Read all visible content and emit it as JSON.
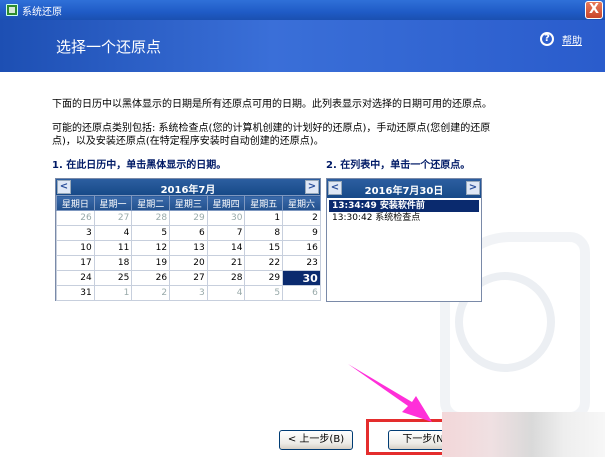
{
  "window": {
    "title": "系统还原",
    "close_glyph": "X"
  },
  "header": {
    "title": "选择一个还原点",
    "help_label": "帮助",
    "help_glyph": "?"
  },
  "description": {
    "line1": "下面的日历中以黑体显示的日期是所有还原点可用的日期。此列表显示对选择的日期可用的还原点。",
    "line2": "可能的还原点类别包括: 系统检查点(您的计算机创建的计划好的还原点)，手动还原点(您创建的还原点)，以及安装还原点(在特定程序安装时自动创建的还原点)。"
  },
  "steps": {
    "step1": "1. 在此日历中，单击黑体显示的日期。",
    "step2": "2. 在列表中，单击一个还原点。"
  },
  "calendar": {
    "month_label": "2016年7月",
    "prev_glyph": "<",
    "next_glyph": ">",
    "weekdays": [
      "星期日",
      "星期一",
      "星期二",
      "星期三",
      "星期四",
      "星期五",
      "星期六"
    ],
    "weeks": [
      [
        {
          "d": "26",
          "o": true
        },
        {
          "d": "27",
          "o": true
        },
        {
          "d": "28",
          "o": true
        },
        {
          "d": "29",
          "o": true
        },
        {
          "d": "30",
          "o": true
        },
        {
          "d": "1",
          "o": false
        },
        {
          "d": "2",
          "o": false
        }
      ],
      [
        {
          "d": "3",
          "o": false
        },
        {
          "d": "4",
          "o": false
        },
        {
          "d": "5",
          "o": false
        },
        {
          "d": "6",
          "o": false
        },
        {
          "d": "7",
          "o": false
        },
        {
          "d": "8",
          "o": false
        },
        {
          "d": "9",
          "o": false
        }
      ],
      [
        {
          "d": "10",
          "o": false
        },
        {
          "d": "11",
          "o": false
        },
        {
          "d": "12",
          "o": false
        },
        {
          "d": "13",
          "o": false
        },
        {
          "d": "14",
          "o": false
        },
        {
          "d": "15",
          "o": false
        },
        {
          "d": "16",
          "o": false
        }
      ],
      [
        {
          "d": "17",
          "o": false
        },
        {
          "d": "18",
          "o": false
        },
        {
          "d": "19",
          "o": false
        },
        {
          "d": "20",
          "o": false
        },
        {
          "d": "21",
          "o": false
        },
        {
          "d": "22",
          "o": false
        },
        {
          "d": "23",
          "o": false
        }
      ],
      [
        {
          "d": "24",
          "o": false
        },
        {
          "d": "25",
          "o": false
        },
        {
          "d": "26",
          "o": false
        },
        {
          "d": "27",
          "o": false
        },
        {
          "d": "28",
          "o": false
        },
        {
          "d": "29",
          "o": false
        },
        {
          "d": "30",
          "o": false,
          "sel": true
        }
      ],
      [
        {
          "d": "31",
          "o": false
        },
        {
          "d": "1",
          "o": true
        },
        {
          "d": "2",
          "o": true
        },
        {
          "d": "3",
          "o": true
        },
        {
          "d": "4",
          "o": true
        },
        {
          "d": "5",
          "o": true
        },
        {
          "d": "6",
          "o": true
        }
      ]
    ]
  },
  "restore_points": {
    "date_label": "2016年7月30日",
    "prev_glyph": "<",
    "next_glyph": ">",
    "items": [
      {
        "label": "13:34:49  安装软件前",
        "selected": true
      },
      {
        "label": "13:30:42  系统检查点",
        "selected": false
      }
    ]
  },
  "buttons": {
    "back_label": "< 上一步(B)",
    "next_label": "下一步(N)"
  },
  "colors": {
    "annotation_red": "#e42d2d",
    "arrow_magenta": "#ff2fd9",
    "selection": "#0a2a6e"
  }
}
